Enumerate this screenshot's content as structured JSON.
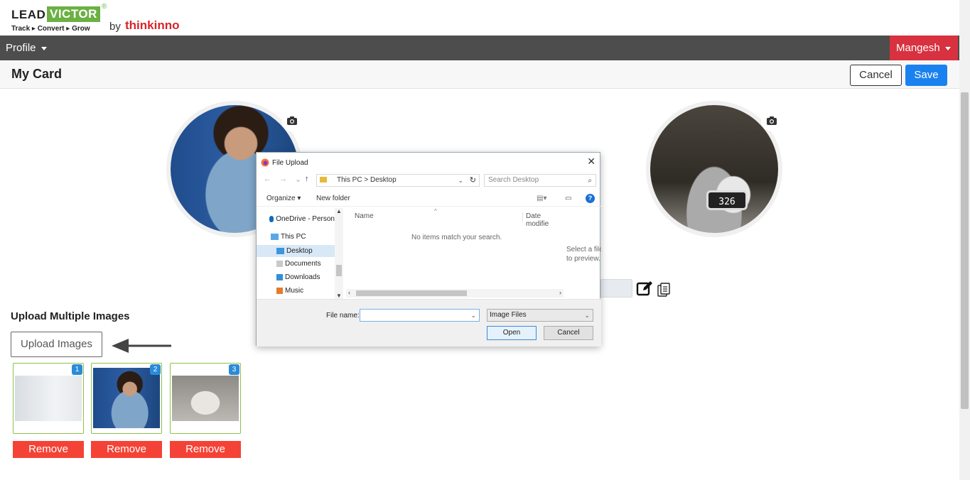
{
  "brand": {
    "lead": "LEAD",
    "victor": "VICTOR",
    "reg": "®",
    "tagline": "Track ▸ Convert ▸ Grow",
    "by": "by",
    "company": "thinkinno",
    "accent": "#6bb043",
    "company_color": "#d6252b"
  },
  "navbar": {
    "profile_label": "Profile",
    "user_label": "Mangesh",
    "user_color": "#d8313f"
  },
  "header": {
    "title": "My Card",
    "cancel_label": "Cancel",
    "save_label": "Save",
    "save_color": "#1a82f0"
  },
  "avatars": {
    "right_device_text": "326"
  },
  "upload": {
    "heading": "Upload Multiple Images",
    "button_label": "Upload Images",
    "thumbnails": [
      {
        "badge": "1",
        "remove_label": "Remove"
      },
      {
        "badge": "2",
        "remove_label": "Remove"
      },
      {
        "badge": "3",
        "remove_label": "Remove"
      }
    ],
    "remove_color": "#f44336"
  },
  "dialog": {
    "title": "File Upload",
    "close": "✕",
    "path": {
      "root": "This PC",
      "sep": ">",
      "folder": "Desktop"
    },
    "search_placeholder": "Search Desktop",
    "toolbar": {
      "organize": "Organize",
      "new_folder": "New folder"
    },
    "tree": [
      {
        "label": "OneDrive - Person",
        "icon": "cloud-icon"
      },
      {
        "label": "This PC",
        "icon": "computer-icon"
      },
      {
        "label": "Desktop",
        "icon": "folder-icon"
      },
      {
        "label": "Documents",
        "icon": "document-icon"
      },
      {
        "label": "Downloads",
        "icon": "download-icon"
      },
      {
        "label": "Music",
        "icon": "music-icon"
      }
    ],
    "columns": {
      "name": "Name",
      "date": "Date modifie"
    },
    "empty_message": "No items match your search.",
    "preview_message_line1": "Select a file",
    "preview_message_line2": "to preview.",
    "file_name_label": "File name:",
    "file_name_value": "",
    "file_type": "Image Files",
    "open_label": "Open",
    "cancel_label": "Cancel"
  }
}
